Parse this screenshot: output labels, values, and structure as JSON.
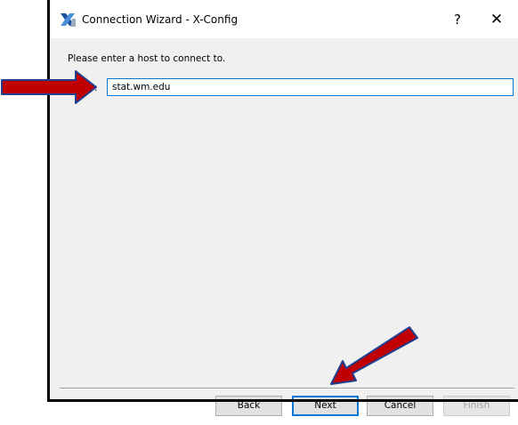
{
  "window": {
    "title": "Connection Wizard - X-Config",
    "help_label": "?",
    "close_label": "✕",
    "icon": "x-config-app-icon"
  },
  "form": {
    "instruction": "Please enter a host to connect to.",
    "host_label_visible": ":",
    "host_value": "stat.wm.edu"
  },
  "buttons": {
    "back": "Back",
    "next": "Next",
    "cancel": "Cancel",
    "finish": "Finish"
  },
  "annotations": {
    "arrow_color": "#c00000",
    "arrow_outline": "#1f3f8f",
    "arrow_icon": "red-arrow-icon"
  }
}
